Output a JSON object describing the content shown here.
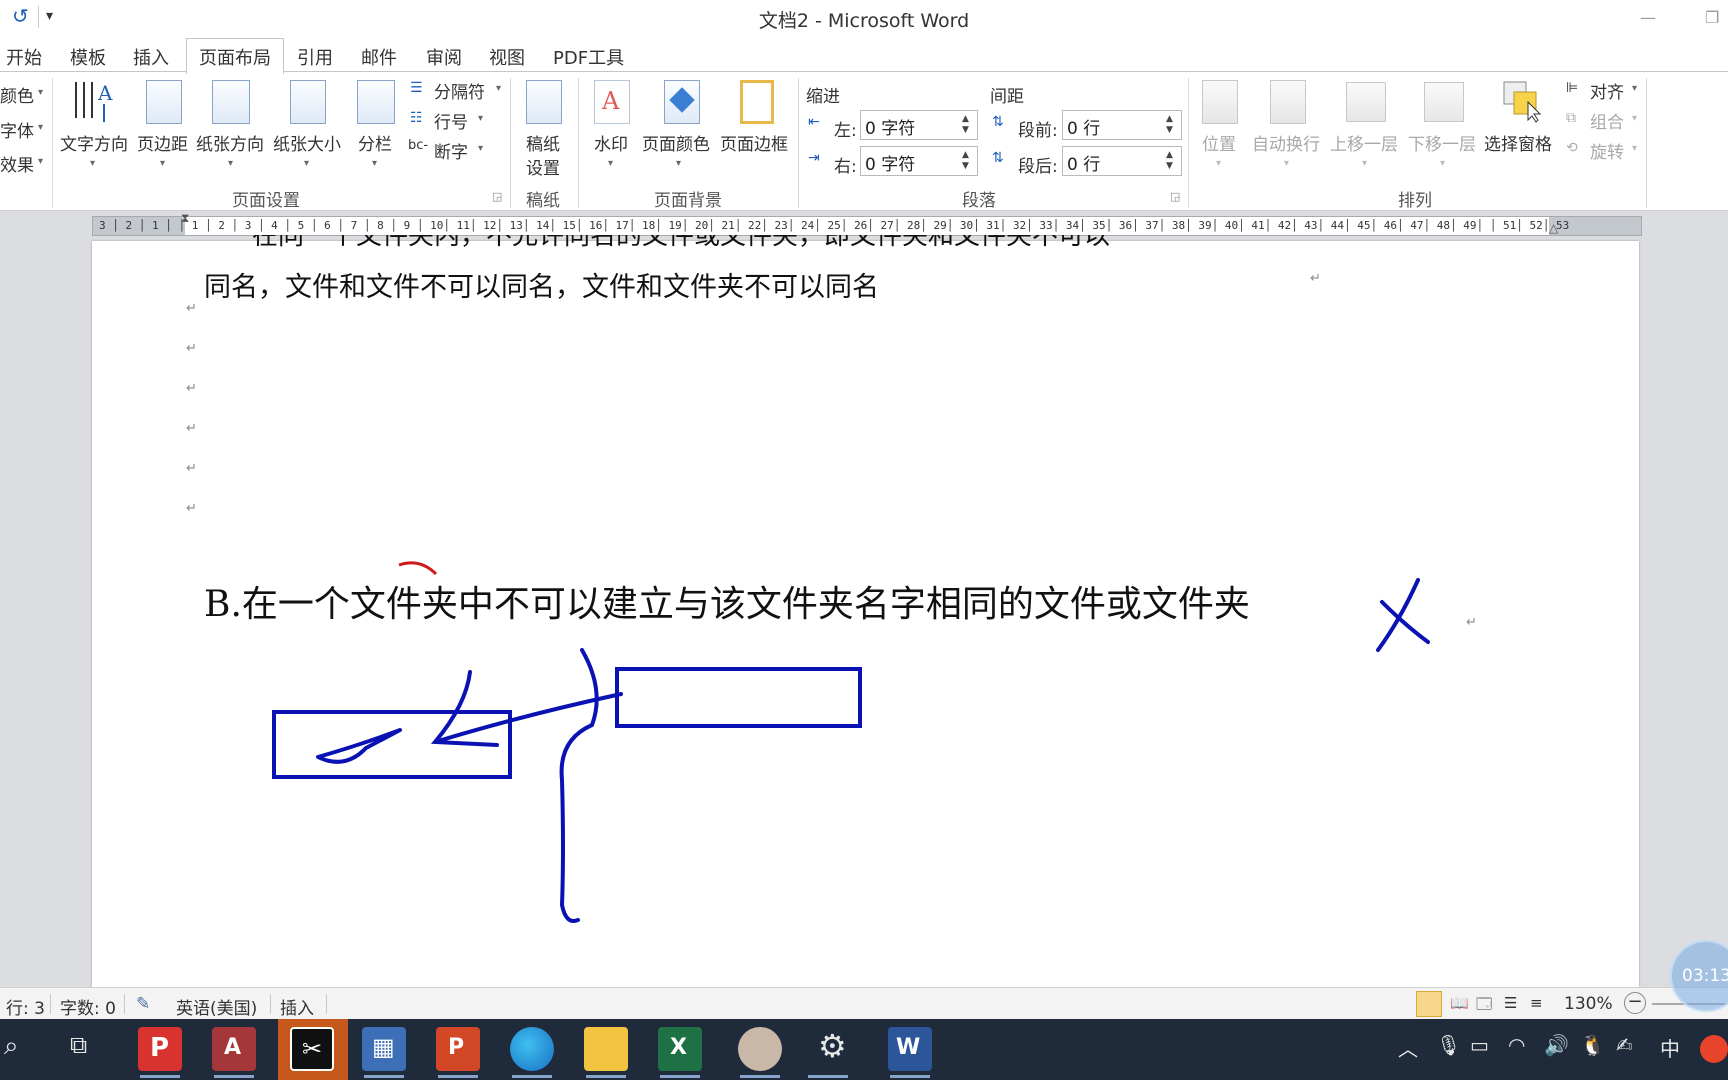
{
  "window": {
    "title": "文档2 - Microsoft Word"
  },
  "quick_access": {
    "undo_icon": "undo-icon",
    "customize_icon": "customize-icon"
  },
  "tabs": [
    {
      "label": "开始"
    },
    {
      "label": "模板"
    },
    {
      "label": "插入"
    },
    {
      "label": "页面布局",
      "active": true
    },
    {
      "label": "引用"
    },
    {
      "label": "邮件"
    },
    {
      "label": "审阅"
    },
    {
      "label": "视图"
    },
    {
      "label": "PDF工具"
    }
  ],
  "ribbon": {
    "theme": {
      "colors": "颜色",
      "fonts": "字体",
      "effects": "效果"
    },
    "page_setup": {
      "text_direction": "文字方向",
      "margins": "页边距",
      "orientation": "纸张方向",
      "size": "纸张大小",
      "columns": "分栏",
      "breaks": "分隔符",
      "line_numbers": "行号",
      "hyphenation": "断字",
      "group": "页面设置"
    },
    "manuscript": {
      "settings_line1": "稿纸",
      "settings_line2": "设置",
      "group": "稿纸"
    },
    "page_background": {
      "watermark": "水印",
      "page_color": "页面颜色",
      "page_borders": "页面边框",
      "group": "页面背景"
    },
    "paragraph": {
      "indent_title": "缩进",
      "spacing_title": "间距",
      "left_label": "左:",
      "left_value": "0 字符",
      "right_label": "右:",
      "right_value": "0 字符",
      "before_label": "段前:",
      "before_value": "0 行",
      "after_label": "段后:",
      "after_value": "0 行",
      "group": "段落"
    },
    "arrange": {
      "position": "位置",
      "wrap_text": "自动换行",
      "bring_forward": "上移一层",
      "send_backward": "下移一层",
      "selection_pane": "选择窗格",
      "align": "对齐",
      "group_objects": "组合",
      "rotate": "旋转",
      "group": "排列"
    }
  },
  "ruler": {
    "ticks": "3 │ 2 │ 1 │   │ 1 │ 2 │ 3 │ 4 │ 5 │ 6 │ 7 │ 8 │ 9 │ 10│ 11│ 12│ 13│ 14│ 15│ 16│ 17│ 18│ 19│ 20│ 21│ 22│ 23│ 24│ 25│ 26│ 27│ 28│ 29│ 30│ 31│ 32│ 33│ 34│ 35│ 36│ 37│ 38│ 39│ 40│ 41│ 42│ 43│ 44│ 45│ 46│ 47│ 48│ 49│   │ 51│ 52│ 53"
  },
  "document": {
    "line1_partial": "在同一个文件夹内，不允许同名的文件或文件夹，即文件夹和文件夹不可以",
    "line2": "同名，文件和文件不可以同名，文件和文件夹不可以同名",
    "para_mark": "↵",
    "option_b": "B.在一个文件夹中不可以建立与该文件夹名字相同的文件或文件夹"
  },
  "status": {
    "line": "行: 3",
    "words": "字数: 0",
    "language": "英语(美国)",
    "mode": "插入",
    "zoom": "130%",
    "timer": "03:13"
  },
  "taskbar": {
    "apps": [
      "search-icon",
      "task-view-icon",
      "pdf-app-icon",
      "access-icon",
      "capcut-icon",
      "calculator-icon",
      "powerpoint-icon",
      "edge-icon",
      "file-explorer-icon",
      "excel-icon",
      "avatar-app-icon",
      "settings-icon",
      "word-icon"
    ],
    "ime": "中"
  },
  "colors": {
    "ink_blue": "#0a12b4",
    "ink_red": "#d01818",
    "taskbar": "#1f2a3a",
    "accent": "#1e5fb8"
  }
}
